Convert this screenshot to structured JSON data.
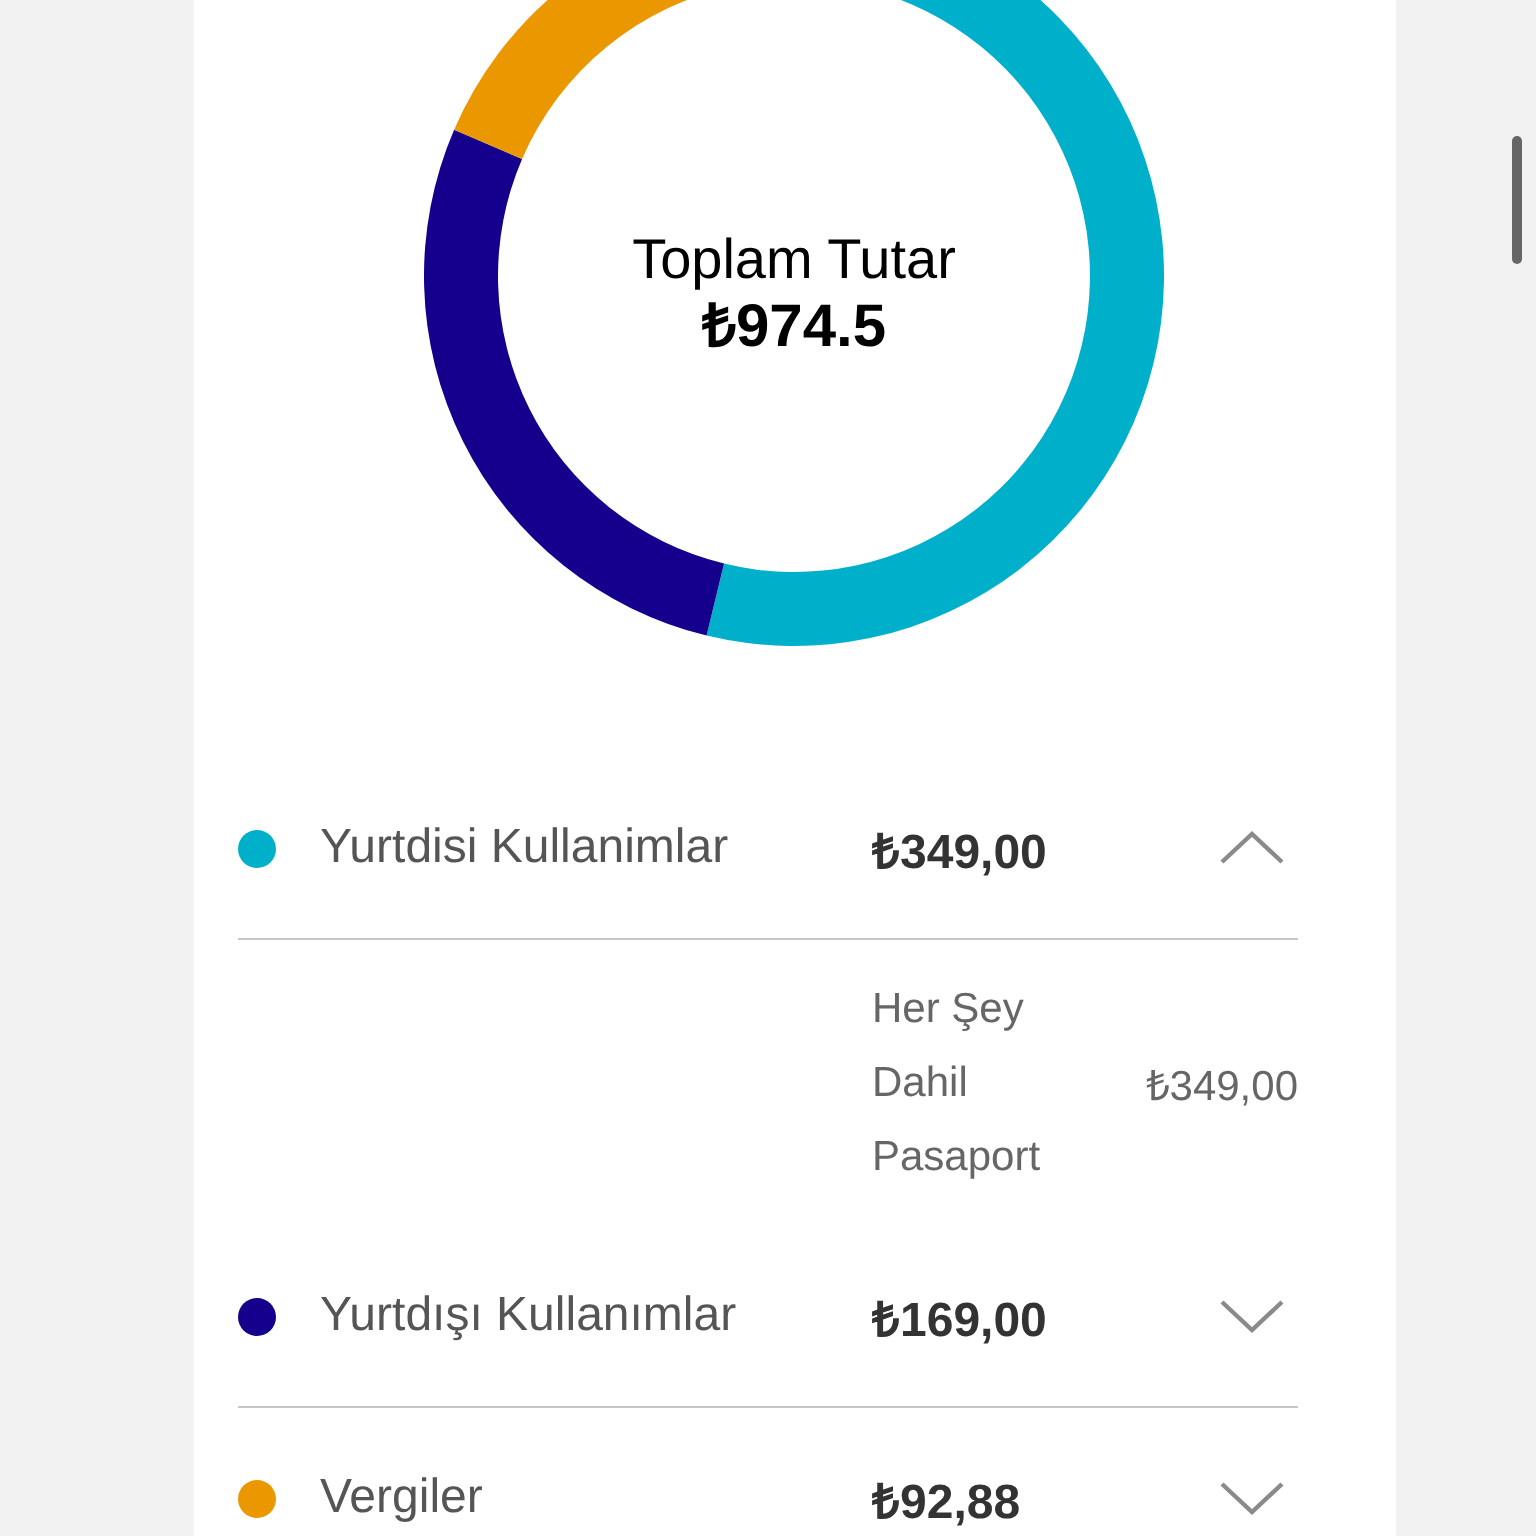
{
  "summary": {
    "title": "Toplam Tutar",
    "total": "₺974.5",
    "chart_data": {
      "type": "donut",
      "values": [
        57.13,
        27.67,
        15.2
      ]
    }
  },
  "items": [
    {
      "name": "Yurtdisi Kullanimlar",
      "amount": "₺349,00",
      "color": "#00b0ca",
      "expanded": true,
      "details": [
        {
          "label": "Her Şey Dahil Pasaport",
          "amount": "₺349,00"
        }
      ]
    },
    {
      "name": "Yurtdışı Kullanımlar",
      "amount": "₺169,00",
      "color": "#14008c",
      "expanded": false
    },
    {
      "name": "Vergiler",
      "amount": "₺92,88",
      "color": "#eb9700",
      "expanded": false
    }
  ]
}
